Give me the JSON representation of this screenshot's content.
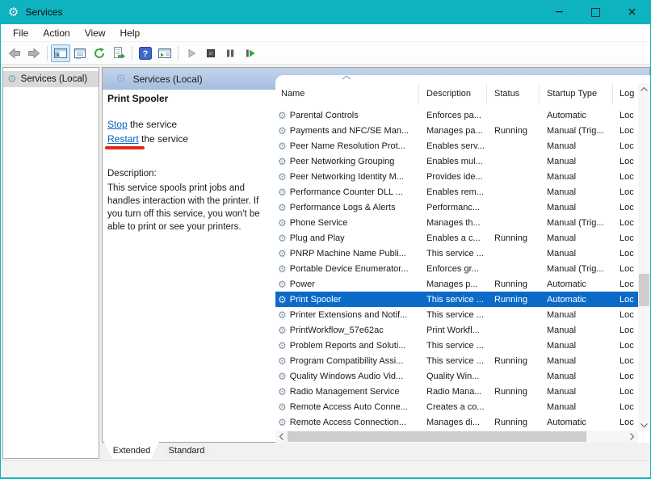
{
  "titlebar": {
    "title": "Services",
    "minimize": "−",
    "maximize": "□",
    "close": "×"
  },
  "menubar": {
    "items": [
      "File",
      "Action",
      "View",
      "Help"
    ]
  },
  "toolbar": {
    "icons": [
      "back",
      "forward",
      "show-console-tree",
      "properties",
      "refresh",
      "export-list",
      "help",
      "show-action-pane",
      "start-service",
      "stop-service",
      "pause-service",
      "restart-service"
    ]
  },
  "sidebar": {
    "root_item": "Services (Local)"
  },
  "extended_view": {
    "header": "Services (Local)",
    "service_title": "Print Spooler",
    "actions": [
      {
        "link": "Stop",
        "suffix": " the service"
      },
      {
        "link": "Restart",
        "suffix": " the service"
      }
    ],
    "description_label": "Description:",
    "description_text": "This service spools print jobs and handles interaction with the printer. If you turn off this service, you won't be able to print or see your printers."
  },
  "services_table": {
    "columns": [
      "Name",
      "Description",
      "Status",
      "Startup Type",
      "Log"
    ],
    "sorted_by": "Name",
    "selected": "Print Spooler",
    "rows": [
      {
        "name": "Parental Controls",
        "description": "Enforces pa...",
        "status": "",
        "startup": "Automatic",
        "log": "Loc"
      },
      {
        "name": "Payments and NFC/SE Man...",
        "description": "Manages pa...",
        "status": "Running",
        "startup": "Manual (Trig...",
        "log": "Loc"
      },
      {
        "name": "Peer Name Resolution Prot...",
        "description": "Enables serv...",
        "status": "",
        "startup": "Manual",
        "log": "Loc"
      },
      {
        "name": "Peer Networking Grouping",
        "description": "Enables mul...",
        "status": "",
        "startup": "Manual",
        "log": "Loc"
      },
      {
        "name": "Peer Networking Identity M...",
        "description": "Provides ide...",
        "status": "",
        "startup": "Manual",
        "log": "Loc"
      },
      {
        "name": "Performance Counter DLL ...",
        "description": "Enables rem...",
        "status": "",
        "startup": "Manual",
        "log": "Loc"
      },
      {
        "name": "Performance Logs & Alerts",
        "description": "Performanc...",
        "status": "",
        "startup": "Manual",
        "log": "Loc"
      },
      {
        "name": "Phone Service",
        "description": "Manages th...",
        "status": "",
        "startup": "Manual (Trig...",
        "log": "Loc"
      },
      {
        "name": "Plug and Play",
        "description": "Enables a c...",
        "status": "Running",
        "startup": "Manual",
        "log": "Loc"
      },
      {
        "name": "PNRP Machine Name Publi...",
        "description": "This service ...",
        "status": "",
        "startup": "Manual",
        "log": "Loc"
      },
      {
        "name": "Portable Device Enumerator...",
        "description": "Enforces gr...",
        "status": "",
        "startup": "Manual (Trig...",
        "log": "Loc"
      },
      {
        "name": "Power",
        "description": "Manages p...",
        "status": "Running",
        "startup": "Automatic",
        "log": "Loc"
      },
      {
        "name": "Print Spooler",
        "description": "This service ...",
        "status": "Running",
        "startup": "Automatic",
        "log": "Loc"
      },
      {
        "name": "Printer Extensions and Notif...",
        "description": "This service ...",
        "status": "",
        "startup": "Manual",
        "log": "Loc"
      },
      {
        "name": "PrintWorkflow_57e62ac",
        "description": "Print Workfl...",
        "status": "",
        "startup": "Manual",
        "log": "Loc"
      },
      {
        "name": "Problem Reports and Soluti...",
        "description": "This service ...",
        "status": "",
        "startup": "Manual",
        "log": "Loc"
      },
      {
        "name": "Program Compatibility Assi...",
        "description": "This service ...",
        "status": "Running",
        "startup": "Manual",
        "log": "Loc"
      },
      {
        "name": "Quality Windows Audio Vid...",
        "description": "Quality Win...",
        "status": "",
        "startup": "Manual",
        "log": "Loc"
      },
      {
        "name": "Radio Management Service",
        "description": "Radio Mana...",
        "status": "Running",
        "startup": "Manual",
        "log": "Loc"
      },
      {
        "name": "Remote Access Auto Conne...",
        "description": "Creates a co...",
        "status": "",
        "startup": "Manual",
        "log": "Loc"
      },
      {
        "name": "Remote Access Connection...",
        "description": "Manages di...",
        "status": "Running",
        "startup": "Automatic",
        "log": "Loc"
      }
    ]
  },
  "view_tabs": {
    "items": [
      "Extended",
      "Standard"
    ],
    "active": "Extended"
  },
  "colors": {
    "titlebar": "#0fb2bf",
    "selection": "#0b6ac8",
    "link": "#0563c1",
    "annotation": "#df2b18",
    "band_top": "#c3d4ec",
    "band_bottom": "#a6bddf"
  }
}
